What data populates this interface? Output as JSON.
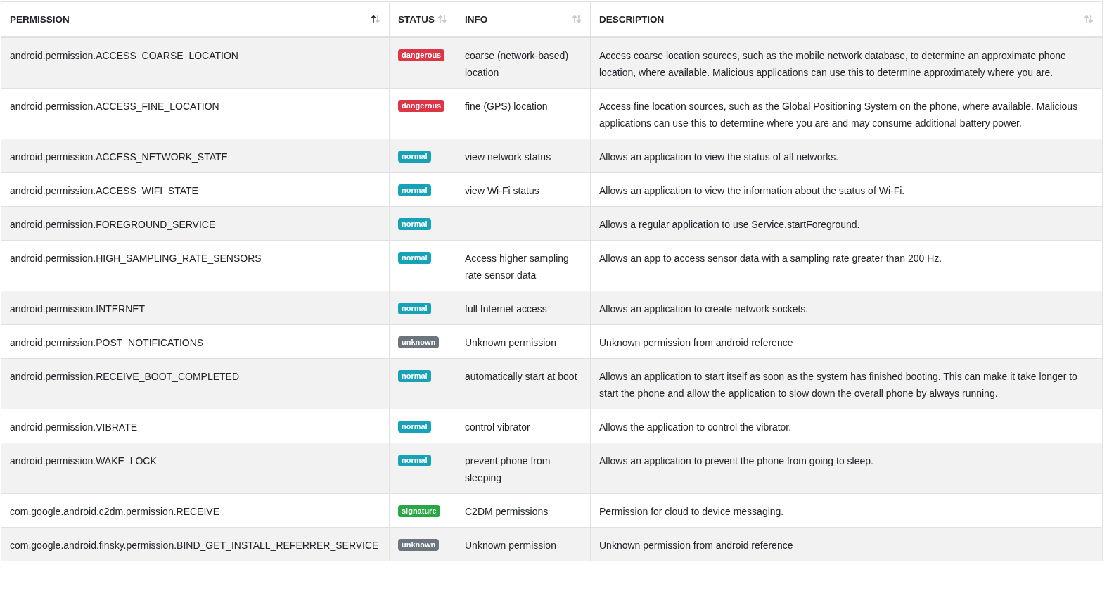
{
  "table": {
    "columns": [
      {
        "label": "PERMISSION",
        "sorted": true
      },
      {
        "label": "STATUS",
        "sorted": false
      },
      {
        "label": "INFO",
        "sorted": false
      },
      {
        "label": "DESCRIPTION",
        "sorted": false
      }
    ],
    "rows": [
      {
        "permission": "android.permission.ACCESS_COARSE_LOCATION",
        "status": {
          "label": "dangerous",
          "kind": "dangerous"
        },
        "info": "coarse (network-based) location",
        "description": "Access coarse location sources, such as the mobile network database, to determine an approximate phone location, where available. Malicious applications can use this to determine approximately where you are."
      },
      {
        "permission": "android.permission.ACCESS_FINE_LOCATION",
        "status": {
          "label": "dangerous",
          "kind": "dangerous"
        },
        "info": "fine (GPS) location",
        "description": "Access fine location sources, such as the Global Positioning System on the phone, where available. Malicious applications can use this to determine where you are and may consume additional battery power."
      },
      {
        "permission": "android.permission.ACCESS_NETWORK_STATE",
        "status": {
          "label": "normal",
          "kind": "normal"
        },
        "info": "view network status",
        "description": "Allows an application to view the status of all networks."
      },
      {
        "permission": "android.permission.ACCESS_WIFI_STATE",
        "status": {
          "label": "normal",
          "kind": "normal"
        },
        "info": "view Wi-Fi status",
        "description": "Allows an application to view the information about the status of Wi-Fi."
      },
      {
        "permission": "android.permission.FOREGROUND_SERVICE",
        "status": {
          "label": "normal",
          "kind": "normal"
        },
        "description": "Allows a regular application to use Service.startForeground."
      },
      {
        "permission": "android.permission.HIGH_SAMPLING_RATE_SENSORS",
        "status": {
          "label": "normal",
          "kind": "normal"
        },
        "info": "Access higher sampling rate sensor data",
        "description": "Allows an app to access sensor data with a sampling rate greater than 200 Hz."
      },
      {
        "permission": "android.permission.INTERNET",
        "status": {
          "label": "normal",
          "kind": "normal"
        },
        "info": "full Internet access",
        "description": "Allows an application to create network sockets."
      },
      {
        "permission": "android.permission.POST_NOTIFICATIONS",
        "status": {
          "label": "unknown",
          "kind": "unknown"
        },
        "info": "Unknown permission",
        "description": "Unknown permission from android reference"
      },
      {
        "permission": "android.permission.RECEIVE_BOOT_COMPLETED",
        "status": {
          "label": "normal",
          "kind": "normal"
        },
        "info": "automatically start at boot",
        "description": "Allows an application to start itself as soon as the system has finished booting. This can make it take longer to start the phone and allow the application to slow down the overall phone by always running."
      },
      {
        "permission": "android.permission.VIBRATE",
        "status": {
          "label": "normal",
          "kind": "normal"
        },
        "info": "control vibrator",
        "description": "Allows the application to control the vibrator."
      },
      {
        "permission": "android.permission.WAKE_LOCK",
        "status": {
          "label": "normal",
          "kind": "normal"
        },
        "info": "prevent phone from sleeping",
        "description": "Allows an application to prevent the phone from going to sleep."
      },
      {
        "permission": "com.google.android.c2dm.permission.RECEIVE",
        "status": {
          "label": "signature",
          "kind": "signature"
        },
        "info": "C2DM permissions",
        "description": "Permission for cloud to device messaging."
      },
      {
        "permission": "com.google.android.finsky.permission.BIND_GET_INSTALL_REFERRER_SERVICE",
        "status": {
          "label": "unknown",
          "kind": "unknown"
        },
        "info": "Unknown permission",
        "description": "Unknown permission from android reference"
      }
    ]
  }
}
